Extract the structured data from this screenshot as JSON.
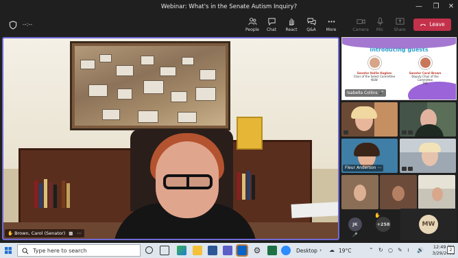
{
  "window": {
    "title": "Webinar: What's in the Senate Autism Inquiry?"
  },
  "toolbar": {
    "timer": "--:--",
    "buttons": [
      {
        "id": "people",
        "label": "People",
        "icon": "people-icon",
        "enabled": true
      },
      {
        "id": "chat",
        "label": "Chat",
        "icon": "chat-icon",
        "enabled": true
      },
      {
        "id": "react",
        "label": "React",
        "icon": "raise-hand-icon",
        "enabled": true
      },
      {
        "id": "qa",
        "label": "Q&A",
        "icon": "qa-icon",
        "enabled": true
      },
      {
        "id": "more",
        "label": "More",
        "icon": "more-icon",
        "enabled": true
      },
      {
        "id": "camera",
        "label": "Camera",
        "icon": "camera-icon",
        "enabled": false
      },
      {
        "id": "mic",
        "label": "Mic",
        "icon": "mic-icon",
        "enabled": false
      },
      {
        "id": "share",
        "label": "Share",
        "icon": "share-icon",
        "enabled": false
      }
    ],
    "leave_label": "Leave"
  },
  "main_video": {
    "name": "Brown, Carol (Senator)"
  },
  "slide": {
    "heading": "Introducing guests",
    "guest1": {
      "name": "Senator Hollie Hughes",
      "role1": "Chair of the Select Committee",
      "role2": "NSW"
    },
    "guest2": {
      "name": "Senator Carol Brown",
      "role1": "Deputy Chair of the Committee",
      "role2": "TAS"
    },
    "presenter": "Isabella Collins"
  },
  "tiles": {
    "fleur": "Fleur Anderson"
  },
  "roster": {
    "initials_jk": "JK",
    "overflow": "+258",
    "initials_mw": "MW"
  },
  "taskbar": {
    "search_placeholder": "Type here to search",
    "desktop_label": "Desktop",
    "weather": "19°C",
    "time": "12:49 PM",
    "date": "3/29/2022",
    "notifications": "2"
  },
  "colors": {
    "leave": "#c4314b",
    "active_border": "#6e6ad8",
    "slide_heading": "#2fa2c9"
  }
}
